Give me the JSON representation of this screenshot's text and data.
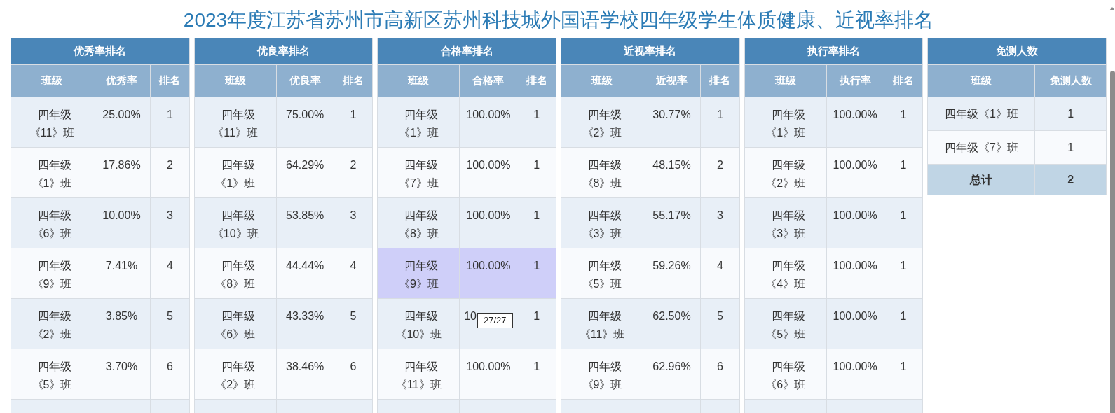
{
  "title": "2023年度江苏省苏州市高新区苏州科技城外国语学校四年级学生体质健康、近视率排名",
  "tables": [
    {
      "title": "优秀率排名",
      "columns": [
        "班级",
        "优秀率",
        "排名"
      ],
      "rows": [
        {
          "cells": [
            "四年级《11》班",
            "25.00%",
            "1"
          ]
        },
        {
          "cells": [
            "四年级《1》班",
            "17.86%",
            "2"
          ]
        },
        {
          "cells": [
            "四年级《6》班",
            "10.00%",
            "3"
          ]
        },
        {
          "cells": [
            "四年级《9》班",
            "7.41%",
            "4"
          ]
        },
        {
          "cells": [
            "四年级《2》班",
            "3.85%",
            "5"
          ]
        },
        {
          "cells": [
            "四年级《5》班",
            "3.70%",
            "6"
          ]
        }
      ]
    },
    {
      "title": "优良率排名",
      "columns": [
        "班级",
        "优良率",
        "排名"
      ],
      "rows": [
        {
          "cells": [
            "四年级《11》班",
            "75.00%",
            "1"
          ]
        },
        {
          "cells": [
            "四年级《1》班",
            "64.29%",
            "2"
          ]
        },
        {
          "cells": [
            "四年级《10》班",
            "53.85%",
            "3"
          ]
        },
        {
          "cells": [
            "四年级《8》班",
            "44.44%",
            "4"
          ]
        },
        {
          "cells": [
            "四年级《6》班",
            "43.33%",
            "5"
          ]
        },
        {
          "cells": [
            "四年级《2》班",
            "38.46%",
            "6"
          ]
        }
      ]
    },
    {
      "title": "合格率排名",
      "columns": [
        "班级",
        "合格率",
        "排名"
      ],
      "rows": [
        {
          "cells": [
            "四年级《1》班",
            "100.00%",
            "1"
          ],
          "highlighted": false
        },
        {
          "cells": [
            "四年级《7》班",
            "100.00%",
            "1"
          ],
          "highlighted": false
        },
        {
          "cells": [
            "四年级《8》班",
            "100.00%",
            "1"
          ],
          "highlighted": false
        },
        {
          "cells": [
            "四年级《9》班",
            "100.00%",
            "1"
          ],
          "highlighted": true
        },
        {
          "cells": [
            "四年级《10》班",
            "10",
            "1"
          ],
          "highlighted": false,
          "tooltip": "27/27"
        },
        {
          "cells": [
            "四年级《11》班",
            "100.00%",
            "1"
          ],
          "highlighted": false
        }
      ]
    },
    {
      "title": "近视率排名",
      "columns": [
        "班级",
        "近视率",
        "排名"
      ],
      "rows": [
        {
          "cells": [
            "四年级《2》班",
            "30.77%",
            "1"
          ]
        },
        {
          "cells": [
            "四年级《8》班",
            "48.15%",
            "2"
          ]
        },
        {
          "cells": [
            "四年级《3》班",
            "55.17%",
            "3"
          ]
        },
        {
          "cells": [
            "四年级《5》班",
            "59.26%",
            "4"
          ]
        },
        {
          "cells": [
            "四年级《11》班",
            "62.50%",
            "5"
          ]
        },
        {
          "cells": [
            "四年级《9》班",
            "62.96%",
            "6"
          ]
        }
      ]
    },
    {
      "title": "执行率排名",
      "columns": [
        "班级",
        "执行率",
        "排名"
      ],
      "rows": [
        {
          "cells": [
            "四年级《1》班",
            "100.00%",
            "1"
          ]
        },
        {
          "cells": [
            "四年级《2》班",
            "100.00%",
            "1"
          ]
        },
        {
          "cells": [
            "四年级《3》班",
            "100.00%",
            "1"
          ]
        },
        {
          "cells": [
            "四年级《4》班",
            "100.00%",
            "1"
          ]
        },
        {
          "cells": [
            "四年级《5》班",
            "100.00%",
            "1"
          ]
        },
        {
          "cells": [
            "四年级《6》班",
            "100.00%",
            "1"
          ]
        }
      ]
    },
    {
      "title": "免测人数",
      "columns": [
        "班级",
        "免测人数"
      ],
      "rows": [
        {
          "cells": [
            "四年级《1》班",
            "1"
          ]
        },
        {
          "cells": [
            "四年级《7》班",
            "1"
          ]
        }
      ],
      "total": [
        "总计",
        "2"
      ]
    }
  ]
}
